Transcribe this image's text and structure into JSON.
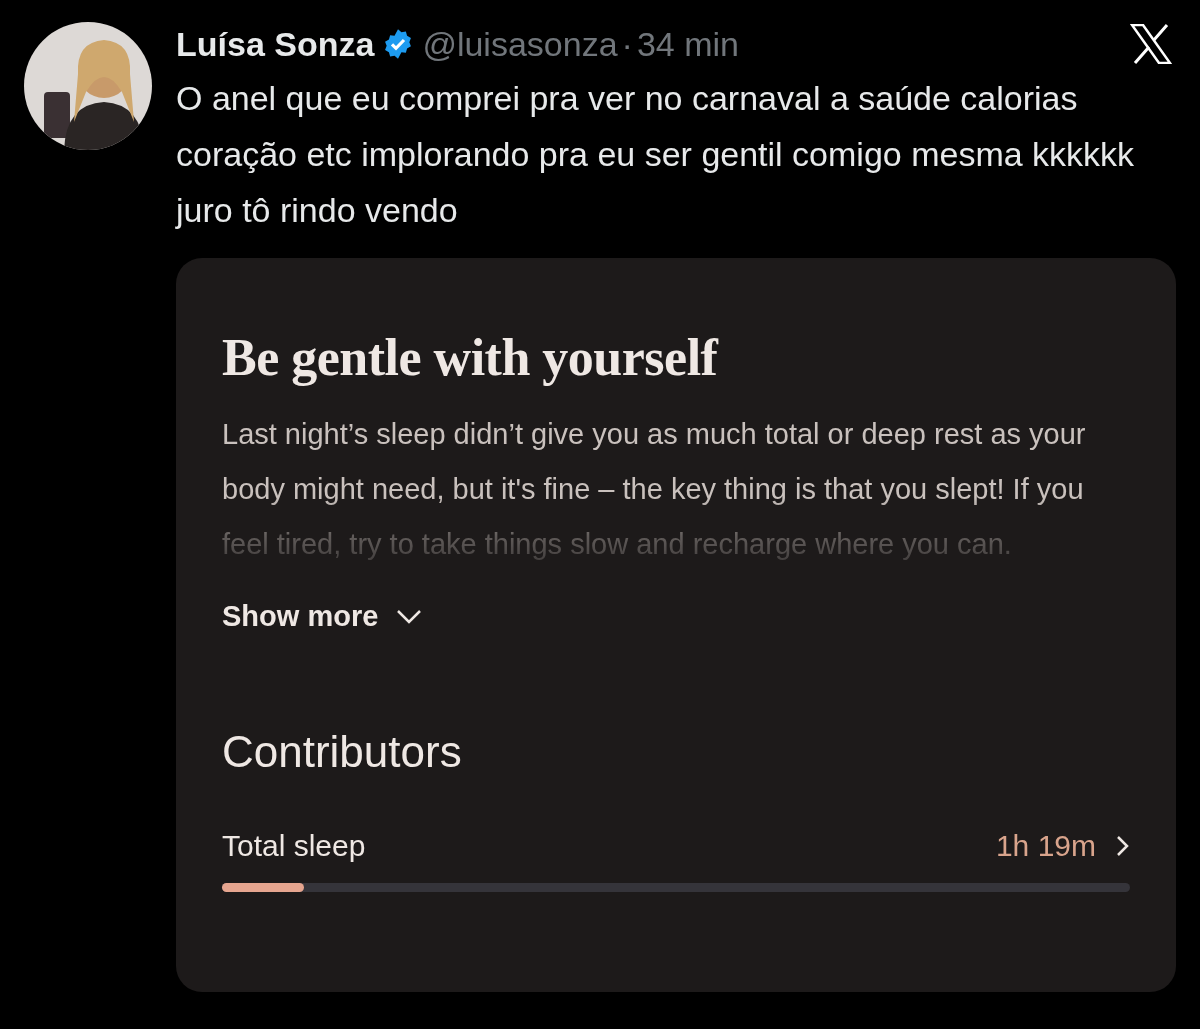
{
  "tweet": {
    "author": {
      "name": "Luísa Sonza",
      "verified": true,
      "handle": "@luisasonza",
      "separator": "·",
      "time": "34 min"
    },
    "text": "O anel que eu comprei pra ver no carnaval a saúde calorias coração etc implorando pra eu ser gentil comigo mesma kkkkkk juro tô rindo vendo",
    "attachment": {
      "heading": "Be gentle with yourself",
      "body": "Last night’s sleep didn’t give you as much total or deep rest as your body might need, but it's fine – the key thing is that you slept! If you feel tired, try to take things slow and recharge where you can.",
      "show_more": "Show more",
      "section_title": "Contributors",
      "contributors": [
        {
          "label": "Total sleep",
          "value": "1h 19m",
          "level": 0.09
        }
      ]
    }
  }
}
